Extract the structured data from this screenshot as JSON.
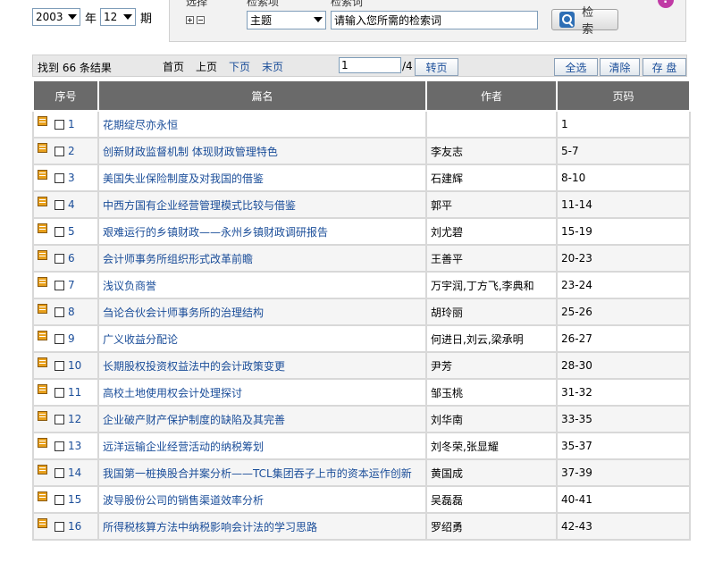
{
  "date": {
    "year": "2003",
    "year_label": "年",
    "month": "12",
    "month_label": "期"
  },
  "search": {
    "label_choose": "选择",
    "label_field": "检索项",
    "label_term": "检索词",
    "field_value": "主题",
    "term_placeholder": "请输入您所需的检索词",
    "button_label": "检 索"
  },
  "results": {
    "found_text": "找到 66 条结果",
    "first": "首页",
    "prev": "上页",
    "next": "下页",
    "last": "末页",
    "page_value": "1",
    "total_pages": "/4",
    "goto": "转页",
    "select_all": "全选",
    "clear": "清除",
    "save": "存 盘"
  },
  "table": {
    "headers": [
      "序号",
      "篇名",
      "作者",
      "页码"
    ],
    "rows": [
      {
        "no": "1",
        "title": "花期绽尽亦永恒",
        "author": "",
        "pages": "1"
      },
      {
        "no": "2",
        "title": "创新财政监督机制 体现财政管理特色",
        "author": "李友志",
        "pages": "5-7"
      },
      {
        "no": "3",
        "title": "美国失业保险制度及对我国的借鉴",
        "author": "石建辉",
        "pages": "8-10"
      },
      {
        "no": "4",
        "title": "中西方国有企业经营管理模式比较与借鉴",
        "author": "郭平",
        "pages": "11-14"
      },
      {
        "no": "5",
        "title": "艰难运行的乡镇财政——永州乡镇财政调研报告",
        "author": "刘尤碧",
        "pages": "15-19"
      },
      {
        "no": "6",
        "title": "会计师事务所组织形式改革前瞻",
        "author": "王善平",
        "pages": "20-23"
      },
      {
        "no": "7",
        "title": "浅议负商誉",
        "author": "万宇润,丁方飞,李典和",
        "pages": "23-24"
      },
      {
        "no": "8",
        "title": "刍论合伙会计师事务所的治理结构",
        "author": "胡玲丽",
        "pages": "25-26"
      },
      {
        "no": "9",
        "title": "广义收益分配论",
        "author": "何进日,刘云,梁承明",
        "pages": "26-27"
      },
      {
        "no": "10",
        "title": "长期股权投资权益法中的会计政策变更",
        "author": "尹芳",
        "pages": "28-30"
      },
      {
        "no": "11",
        "title": "高校土地使用权会计处理探讨",
        "author": "邹玉桃",
        "pages": "31-32"
      },
      {
        "no": "12",
        "title": "企业破产财产保护制度的缺陷及其完善",
        "author": "刘华南",
        "pages": "33-35"
      },
      {
        "no": "13",
        "title": "远洋运输企业经营活动的纳税筹划",
        "author": "刘冬荣,张显耀",
        "pages": "35-37"
      },
      {
        "no": "14",
        "title": "我国第一桩换股合并案分析——TCL集团吞子上市的资本运作创新",
        "author": "黄国成",
        "pages": "37-39"
      },
      {
        "no": "15",
        "title": "波导股份公司的销售渠道效率分析",
        "author": "吴磊磊",
        "pages": "40-41"
      },
      {
        "no": "16",
        "title": "所得税核算方法中纳税影响会计法的学习思路",
        "author": "罗绍勇",
        "pages": "42-43"
      }
    ]
  }
}
